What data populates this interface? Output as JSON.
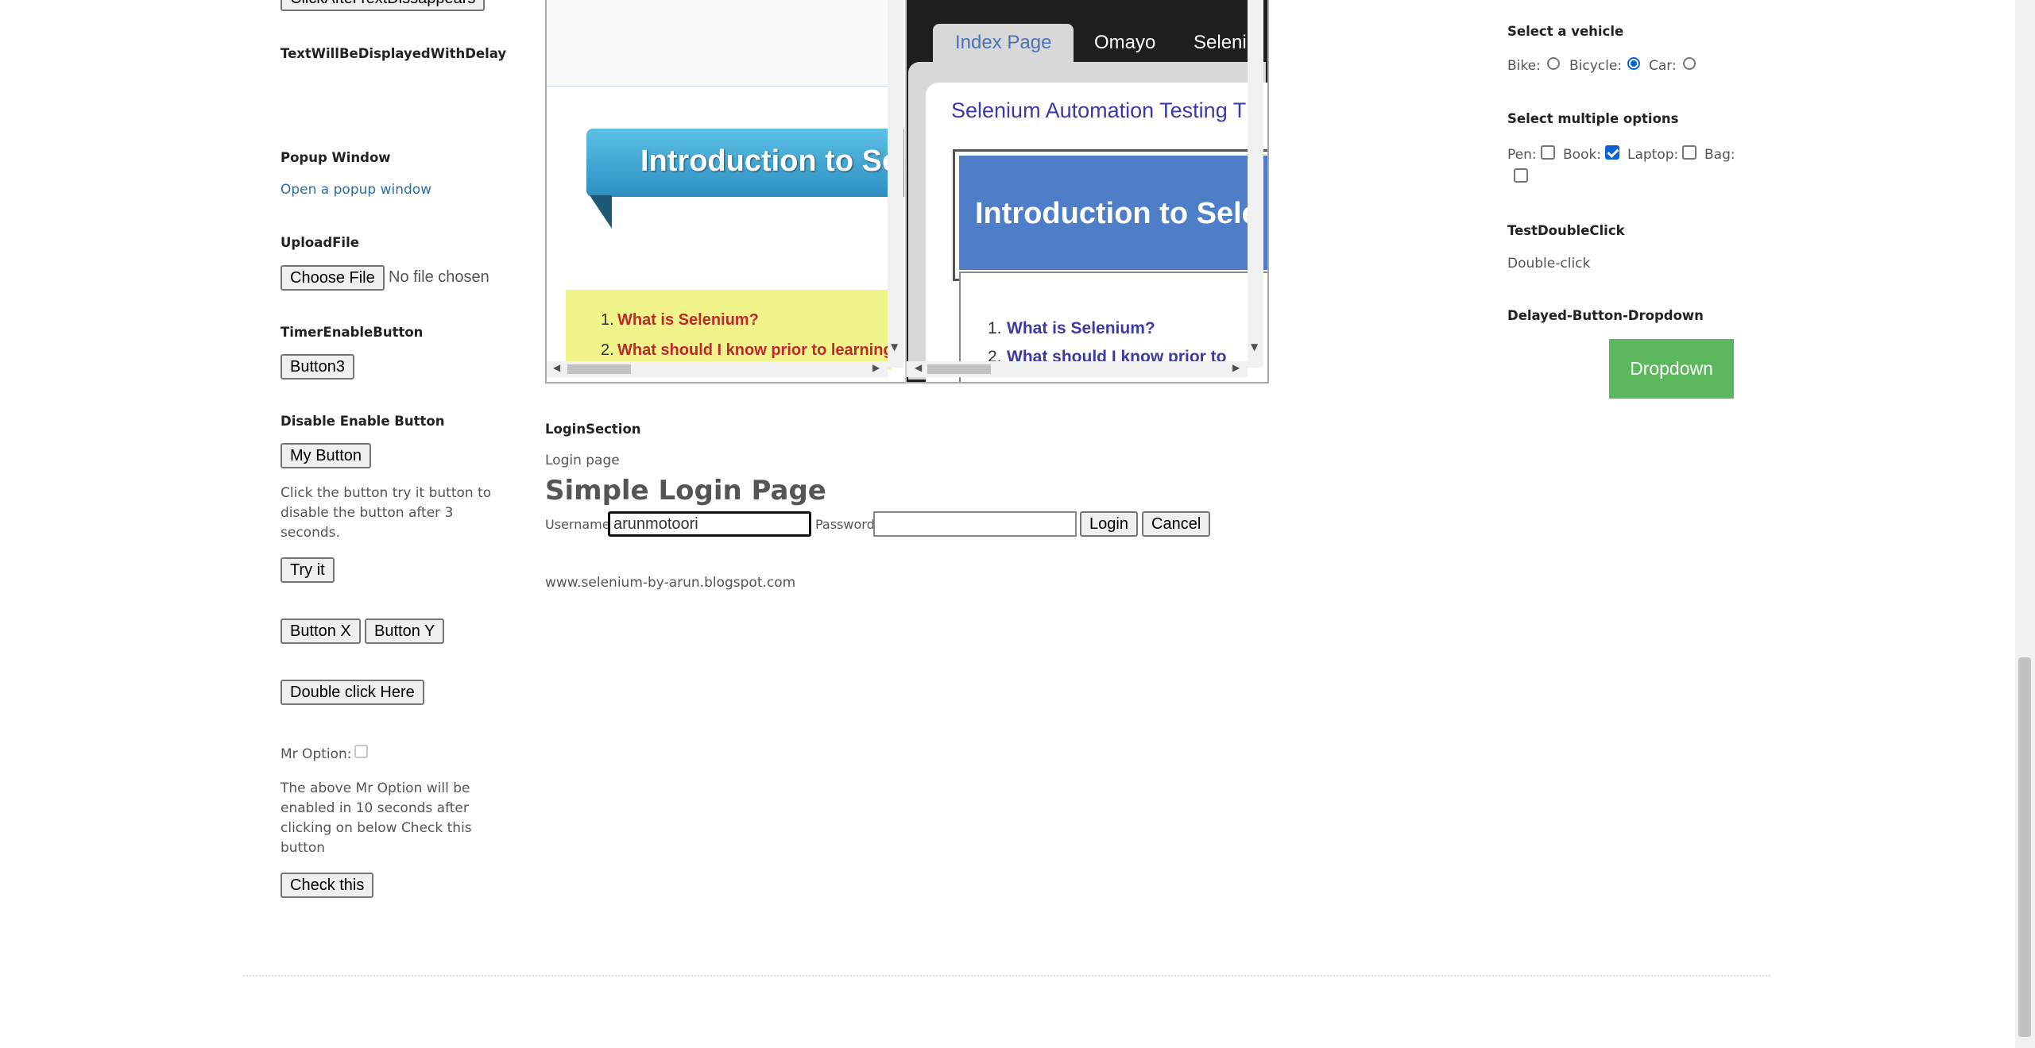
{
  "left": {
    "top_button_label": "ClickAfterTextDissappears",
    "delay_heading": "TextWillBeDisplayedWithDelay",
    "popup_heading": "Popup Window",
    "popup_link": "Open a popup window",
    "upload_heading": "UploadFile",
    "choose_file_label": "Choose File",
    "no_file_text": "No file chosen",
    "timer_heading": "TimerEnableButton",
    "button3_label": "Button3",
    "disable_heading": "Disable Enable Button",
    "my_button_label": "My Button",
    "disable_desc": "Click the button try it button to disable the button after 3 seconds.",
    "try_it_label": "Try it",
    "button_x_label": "Button X",
    "button_y_label": "Button Y",
    "double_click_label": "Double click Here",
    "mr_option_label": "Mr Option:",
    "mr_option_desc": "The above Mr Option will be enabled in 10 seconds after clicking on below Check this button",
    "check_this_label": "Check this"
  },
  "iframe1": {
    "banner_text": "Introduction to Se",
    "item1": "What is Selenium?",
    "item2": "What should I know prior to learning",
    "num1": "1.",
    "num2": "2."
  },
  "iframe2": {
    "tabs": [
      "Index Page",
      "Omayo",
      "Seleniu"
    ],
    "title": "Selenium Automation Testing T",
    "banner_text": "Introduction to Sele",
    "item1": "What is Selenium?",
    "item2": "What should I know prior to",
    "num1": "1.",
    "num2": "2."
  },
  "login": {
    "section_heading": "LoginSection",
    "page_label": "Login page",
    "title": "Simple Login Page",
    "username_label": "Username",
    "username_value": "arunmotoori",
    "password_label": "Password",
    "password_value": "",
    "login_label": "Login",
    "cancel_label": "Cancel",
    "footer_link": "www.selenium-by-arun.blogspot.com"
  },
  "right": {
    "vehicle_heading": "Select a vehicle",
    "bike_label": "Bike:",
    "bicycle_label": "Bicycle:",
    "car_label": "Car:",
    "vehicle_selected": "Bicycle",
    "options_heading": "Select multiple options",
    "pen_label": "Pen:",
    "book_label": "Book:",
    "laptop_label": "Laptop:",
    "bag_label": "Bag:",
    "checked_option": "Book",
    "dblclick_heading": "TestDoubleClick",
    "dblclick_text": "Double-click",
    "dropdown_heading": "Delayed-Button-Dropdown",
    "dropdown_label": "Dropdown",
    "dropdown_color": "#5cb85c"
  }
}
